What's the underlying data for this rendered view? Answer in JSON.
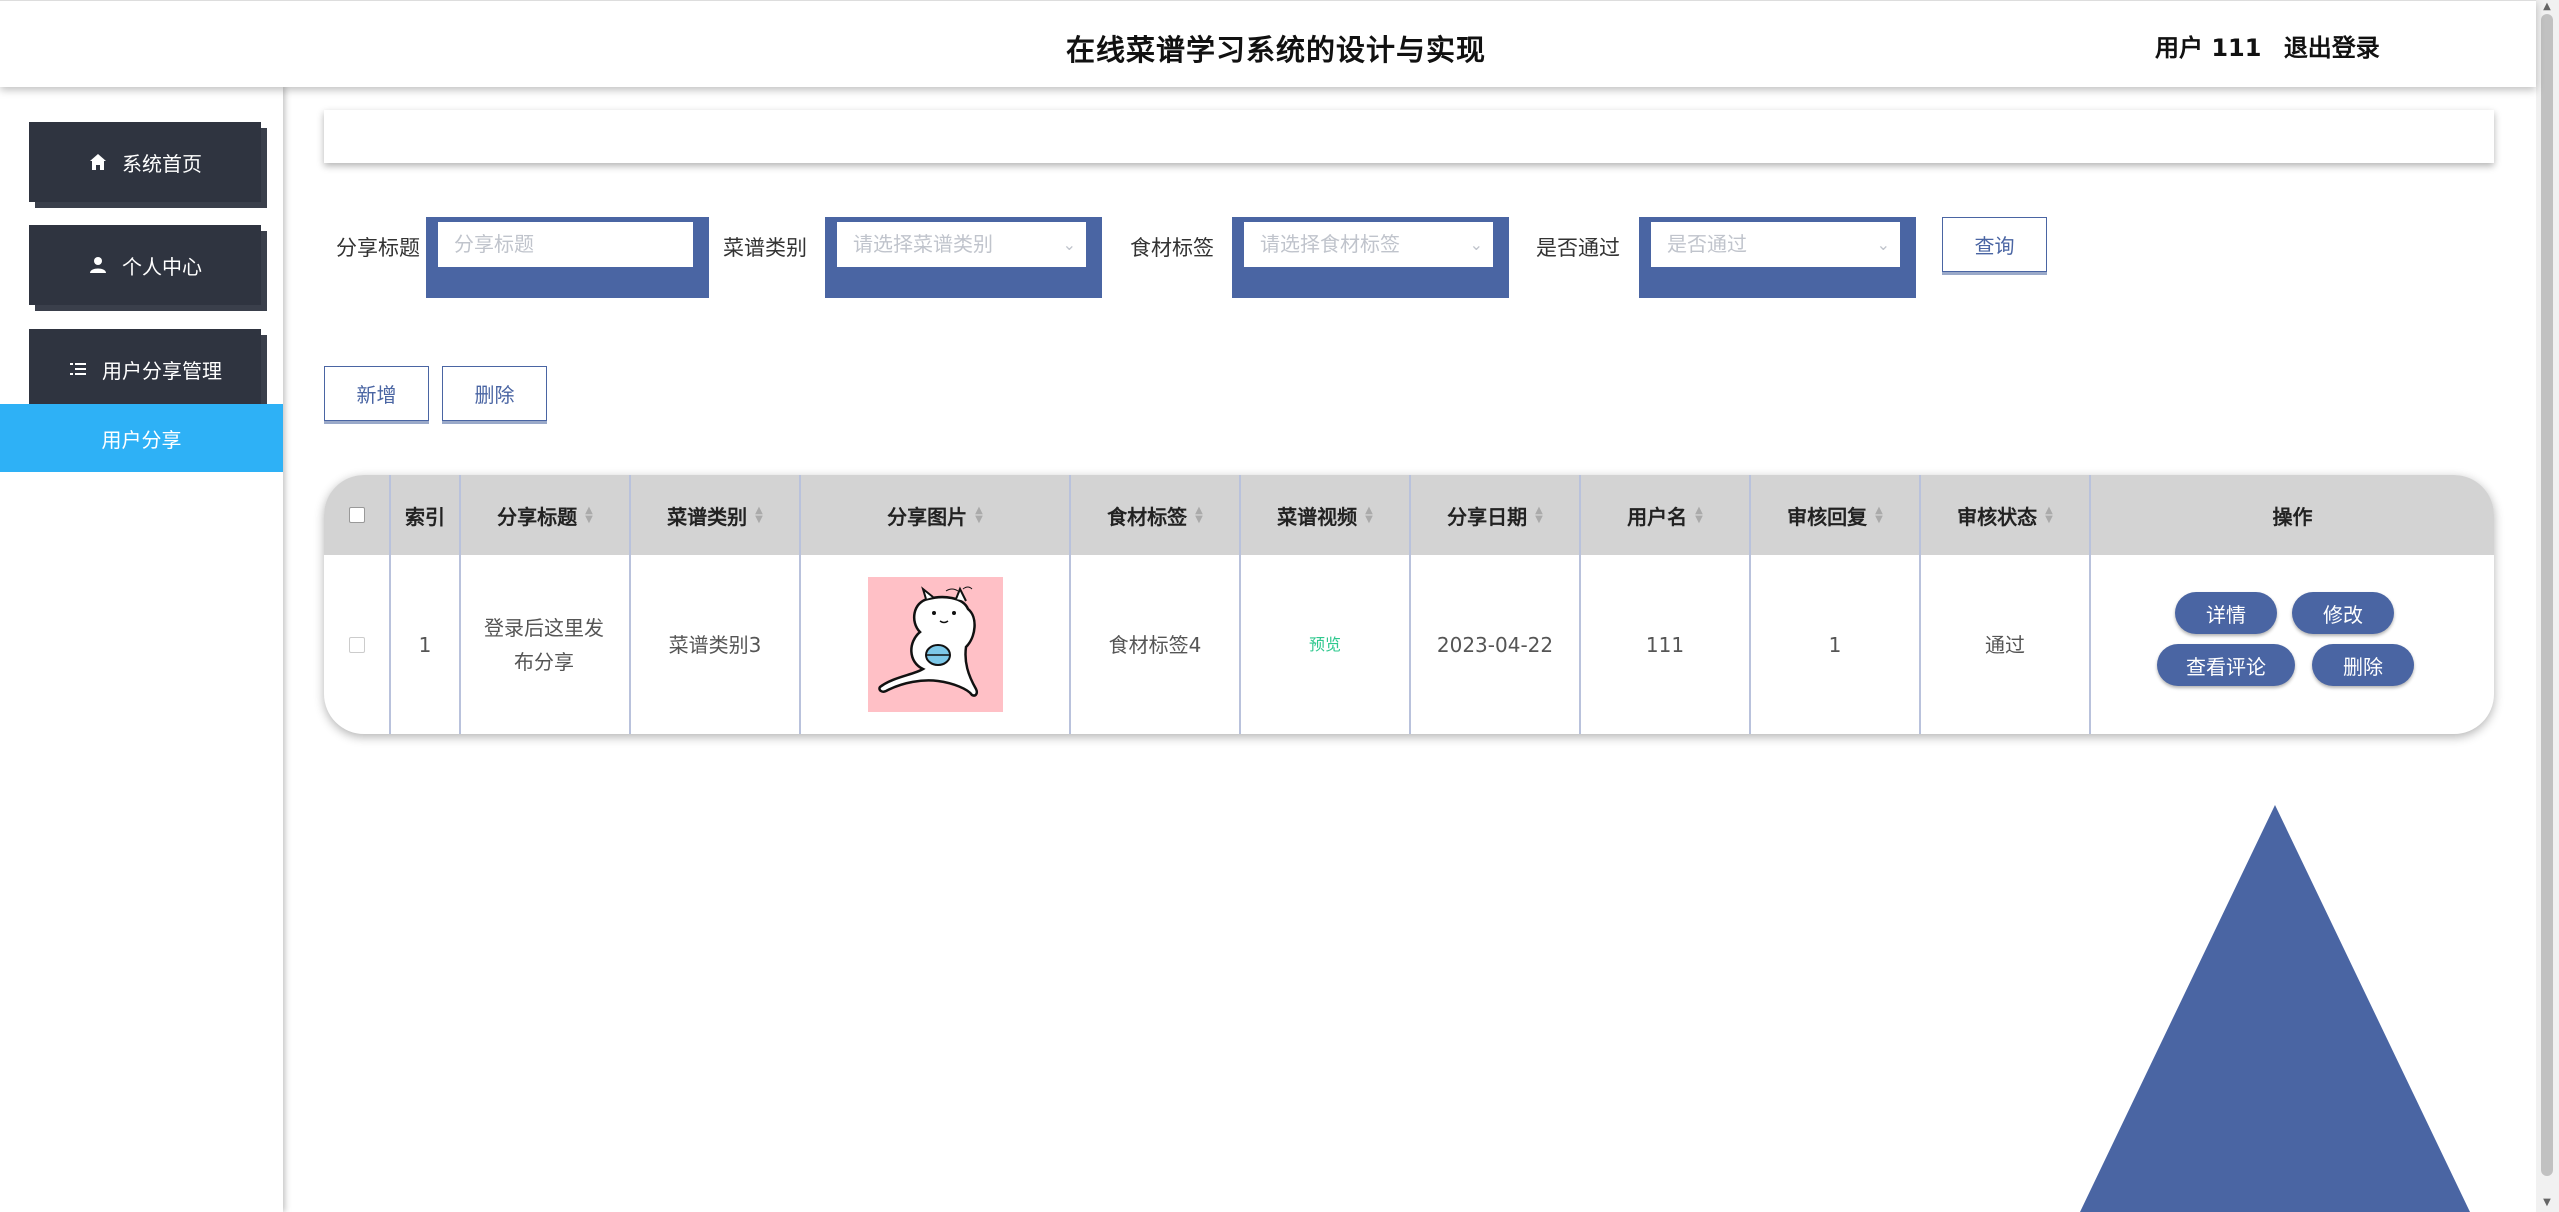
{
  "header": {
    "title": "在线菜谱学习系统的设计与实现",
    "user_label": "用户 111",
    "logout_label": "退出登录"
  },
  "sidebar": {
    "items": [
      {
        "label": "系统首页",
        "icon": "home-icon"
      },
      {
        "label": "个人中心",
        "icon": "user-icon"
      },
      {
        "label": "用户分享管理",
        "icon": "list-icon"
      }
    ],
    "active_sub": "用户分享"
  },
  "filters": {
    "title_label": "分享标题",
    "title_placeholder": "分享标题",
    "category_label": "菜谱类别",
    "category_placeholder": "请选择菜谱类别",
    "tag_label": "食材标签",
    "tag_placeholder": "请选择食材标签",
    "pass_label": "是否通过",
    "pass_placeholder": "是否通过",
    "query_label": "查询"
  },
  "actions": {
    "add_label": "新增",
    "delete_label": "删除"
  },
  "table": {
    "headers": [
      "索引",
      "分享标题",
      "菜谱类别",
      "分享图片",
      "食材标签",
      "菜谱视频",
      "分享日期",
      "用户名",
      "审核回复",
      "审核状态",
      "操作"
    ],
    "rows": [
      {
        "index": "1",
        "title": "登录后这里发布分享",
        "category": "菜谱类别3",
        "tag": "食材标签4",
        "video": "预览",
        "date": "2023-04-22",
        "username": "111",
        "reply": "1",
        "status": "通过",
        "ops": {
          "detail": "详情",
          "edit": "修改",
          "comments": "查看评论",
          "delete": "删除"
        }
      }
    ]
  },
  "colors": {
    "primary": "#4a65a3",
    "sidebar_dark": "#2f3440",
    "active": "#2eb1f6",
    "image_bg": "#ffc0c6"
  }
}
